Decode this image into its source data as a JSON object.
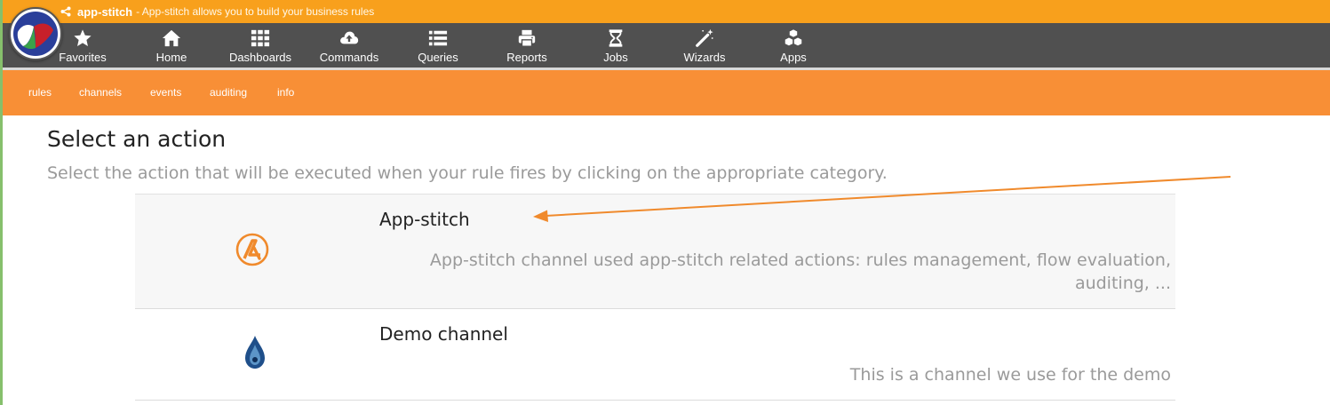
{
  "app": {
    "name": "app-stitch",
    "tagline": "- App-stitch allows you to build your business rules"
  },
  "nav": [
    {
      "label": "Favorites",
      "icon": "star-icon"
    },
    {
      "label": "Home",
      "icon": "home-icon"
    },
    {
      "label": "Dashboards",
      "icon": "grid-icon"
    },
    {
      "label": "Commands",
      "icon": "cloud-upload-icon"
    },
    {
      "label": "Queries",
      "icon": "list-icon"
    },
    {
      "label": "Reports",
      "icon": "printer-icon"
    },
    {
      "label": "Jobs",
      "icon": "hourglass-icon"
    },
    {
      "label": "Wizards",
      "icon": "magic-wand-icon"
    },
    {
      "label": "Apps",
      "icon": "cubes-icon"
    }
  ],
  "subnav": [
    "rules",
    "channels",
    "events",
    "auditing",
    "info"
  ],
  "page": {
    "title": "Select an action",
    "subtitle": "Select the action that will be executed when your rule fires by clicking on the appropriate category."
  },
  "channels": [
    {
      "name": "App-stitch",
      "icon": "app-stitch-logo-icon",
      "description": "App-stitch channel used app-stitch related actions: rules management, flow evaluation, auditing, ..."
    },
    {
      "name": "Demo channel",
      "icon": "water-drop-icon",
      "description": "This is a channel we use for the demo"
    }
  ],
  "colors": {
    "top_bar": "#f8a01c",
    "nav_bar": "#505050",
    "sub_nav": "#f88f36",
    "annotation_arrow": "#f08a2c"
  }
}
